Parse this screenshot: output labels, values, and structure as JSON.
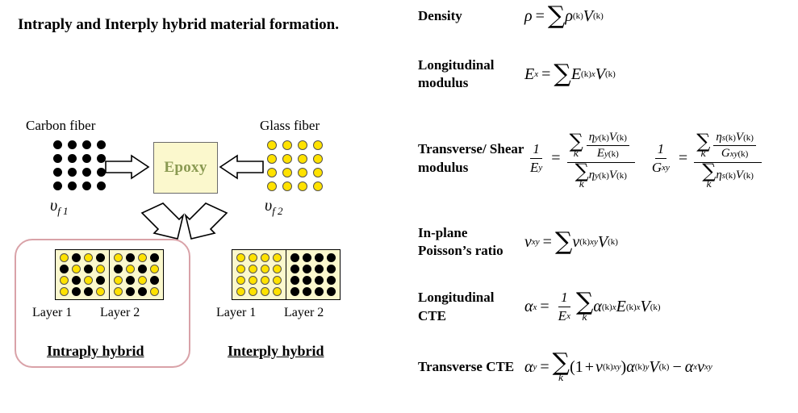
{
  "title": "Intraply and Interply hybrid material formation.",
  "diagram": {
    "carbon_fiber_label": "Carbon fiber",
    "glass_fiber_label": "Glass fiber",
    "epoxy_label": "Epoxy",
    "volume_fraction_1": "υ",
    "volume_fraction_1_sub": "f 1",
    "volume_fraction_2": "υ",
    "volume_fraction_2_sub": "f 2",
    "carbon_grid": {
      "rows": 4,
      "cols": 4,
      "color": "#000000"
    },
    "glass_grid": {
      "rows": 4,
      "cols": 4,
      "color": "#ffe200"
    },
    "intraply": {
      "layer1_caption": "Layer 1",
      "layer2_caption": "Layer 2",
      "hybrid_caption": "Intraply  hybrid",
      "layer1_pattern": [
        [
          "yellow",
          "black",
          "yellow",
          "black"
        ],
        [
          "black",
          "yellow",
          "black",
          "yellow"
        ],
        [
          "yellow",
          "black",
          "yellow",
          "black"
        ],
        [
          "yellow",
          "black",
          "black",
          "yellow"
        ]
      ],
      "layer2_pattern": [
        [
          "yellow",
          "black",
          "yellow",
          "black"
        ],
        [
          "black",
          "yellow",
          "black",
          "yellow"
        ],
        [
          "yellow",
          "black",
          "yellow",
          "black"
        ],
        [
          "yellow",
          "black",
          "black",
          "yellow"
        ]
      ],
      "highlight_color": "#d9a2a8"
    },
    "interply": {
      "layer1_caption": "Layer 1",
      "layer2_caption": "Layer 2",
      "hybrid_caption": "Interply  hybrid",
      "layer1_pattern": [
        [
          "yellow",
          "yellow",
          "yellow",
          "yellow"
        ],
        [
          "yellow",
          "yellow",
          "yellow",
          "yellow"
        ],
        [
          "yellow",
          "yellow",
          "yellow",
          "yellow"
        ],
        [
          "yellow",
          "yellow",
          "yellow",
          "yellow"
        ]
      ],
      "layer2_pattern": [
        [
          "black",
          "black",
          "black",
          "black"
        ],
        [
          "black",
          "black",
          "black",
          "black"
        ],
        [
          "black",
          "black",
          "black",
          "black"
        ],
        [
          "black",
          "black",
          "black",
          "black"
        ]
      ]
    },
    "matrix_fill": "#fbf8cd",
    "epoxy_text_color": "#8a9a52"
  },
  "equations": {
    "density": {
      "label": "Density",
      "lhs": "ρ",
      "rhs_symbol": "ρ",
      "sum_index": "",
      "superscript": "(k)",
      "volume": "V",
      "volume_superscript": "(k)"
    },
    "longitudinal_modulus": {
      "label": "Longitudinal modulus",
      "lhs": "E",
      "lhs_sub": "x",
      "rhs_symbol": "E",
      "rhs_sub": "x",
      "superscript": "(k)",
      "volume": "V",
      "volume_superscript": "(k)"
    },
    "transverse_shear_modulus": {
      "label": "Transverse/ Shear modulus",
      "part1": {
        "lhs_num": "1",
        "lhs_den": "E",
        "lhs_den_sub": "y",
        "num_eta": "η",
        "num_eta_sub": "y",
        "num_sup": "(k)",
        "num_v": "V",
        "num_v_sup": "(k)",
        "num_den": "E",
        "num_den_sub": "y",
        "num_den_sup": "(k)",
        "den_eta": "η",
        "den_eta_sub": "y",
        "den_sup": "(k)",
        "den_v": "V",
        "den_v_sup": "(k)",
        "sum_index": "k"
      },
      "part2": {
        "lhs_num": "1",
        "lhs_den": "G",
        "lhs_den_sub": "xy",
        "num_eta": "η",
        "num_eta_sub": "s",
        "num_sup": "(k)",
        "num_v": "V",
        "num_v_sup": "(k)",
        "num_den": "G",
        "num_den_sub": "xy",
        "num_den_sup": "(k)",
        "den_eta": "η",
        "den_eta_sub": "s",
        "den_sup": "(k)",
        "den_v": "V",
        "den_v_sup": "(k)",
        "sum_index": "k"
      }
    },
    "poisson_ratio": {
      "label": "In-plane Poisson’s ratio",
      "lhs": "ν",
      "lhs_sub": "xy",
      "rhs_symbol": "ν",
      "rhs_sub": "xy",
      "superscript": "(k)",
      "volume": "V",
      "volume_superscript": "(k)"
    },
    "longitudinal_cte": {
      "label": "Longitudinal CTE",
      "lhs": "α",
      "lhs_sub": "x",
      "frac_num": "1",
      "frac_den": "E",
      "frac_den_sub": "x",
      "sum_index": "k",
      "alpha": "α",
      "alpha_sub": "x",
      "alpha_sup": "(k)",
      "modulus": "E",
      "modulus_sub": "x",
      "modulus_sup": "(k)",
      "volume": "V",
      "volume_superscript": "(k)"
    },
    "transverse_cte": {
      "label": "Transverse CTE",
      "lhs": "α",
      "lhs_sub": "y",
      "sum_index": "k",
      "nu": "ν",
      "nu_sub": "xy",
      "nu_sup": "(k)",
      "alpha": "α",
      "alpha_sub": "y",
      "alpha_sup": "(k)",
      "volume": "V",
      "volume_superscript": "(k)",
      "last_alpha": "α",
      "last_alpha_sub": "x",
      "last_nu": "ν",
      "last_nu_sub": "xy"
    }
  }
}
